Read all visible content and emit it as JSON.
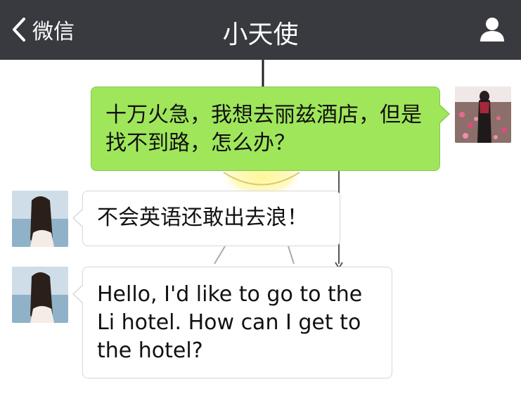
{
  "nav": {
    "back_label": "微信",
    "title": "小天使",
    "back_icon": "chevron-left-icon",
    "profile_icon": "user-icon"
  },
  "colors": {
    "nav_bg": "#393a3f",
    "sent_bubble": "#9fe65b",
    "received_bubble": "#ffffff"
  },
  "messages": [
    {
      "sender": "me",
      "text": "十万火急，我想去丽兹酒店，但是找不到路，怎么办？"
    },
    {
      "sender": "other",
      "text": "不会英语还敢出去浪！"
    },
    {
      "sender": "other",
      "text": "Hello, I'd like to go to the Li hotel. How can I get to the hotel?"
    }
  ]
}
